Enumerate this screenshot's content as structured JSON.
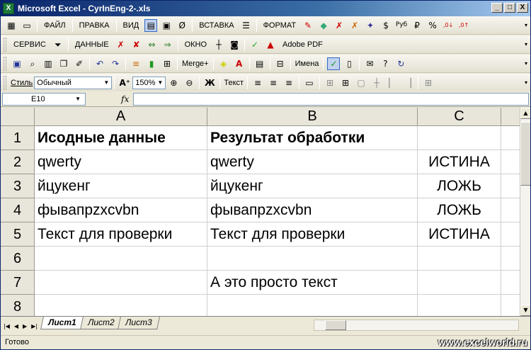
{
  "window": {
    "title": "Microsoft Excel - CyrInEng-2-.xls",
    "app_icon_letter": "X",
    "minimize": "_",
    "maximize": "□",
    "close": "X"
  },
  "menu": {
    "file": "ФАЙЛ",
    "edit": "ПРАВКА",
    "view": "ВИД",
    "insert": "ВСТАВКА",
    "format": "ФОРМАТ",
    "service": "СЕРВИС",
    "data": "ДАННЫЕ",
    "window": "ОКНО",
    "adobe": "Adobe PDF"
  },
  "toolbar": {
    "merge_label": "Merge+",
    "names_label": "Имена",
    "style_label": "Стиль",
    "style_value": "Обычный",
    "zoom_value": "150%",
    "text_label": "Текст",
    "bold_label": "Ж"
  },
  "formula_bar": {
    "name_box": "E10",
    "fx": "fx",
    "formula": ""
  },
  "sheet": {
    "columns": [
      "A",
      "B",
      "C"
    ],
    "rows": [
      {
        "num": "1",
        "a": "Исодные данные",
        "b": "Результат обработки",
        "c": ""
      },
      {
        "num": "2",
        "a": "qwerty",
        "b": "qwerty",
        "c": "ИСТИНА"
      },
      {
        "num": "3",
        "a": "йцукенг",
        "b": "йцукенг",
        "c": "ЛОЖЬ"
      },
      {
        "num": "4",
        "a": "фывапрzxcvbn",
        "b": "фывапрzxcvbn",
        "c": "ЛОЖЬ"
      },
      {
        "num": "5",
        "a": "Текст для проверки",
        "b": "Текст для проверки",
        "c": "ИСТИНА"
      },
      {
        "num": "6",
        "a": "",
        "b": "",
        "c": ""
      },
      {
        "num": "7",
        "a": "",
        "b": "А это просто текст",
        "c": ""
      },
      {
        "num": "8",
        "a": "",
        "b": "",
        "c": ""
      }
    ]
  },
  "tabs": [
    "Лист1",
    "Лист2",
    "Лист3"
  ],
  "status": {
    "text": "Готово",
    "watermark": "www.excelworld.ru"
  }
}
